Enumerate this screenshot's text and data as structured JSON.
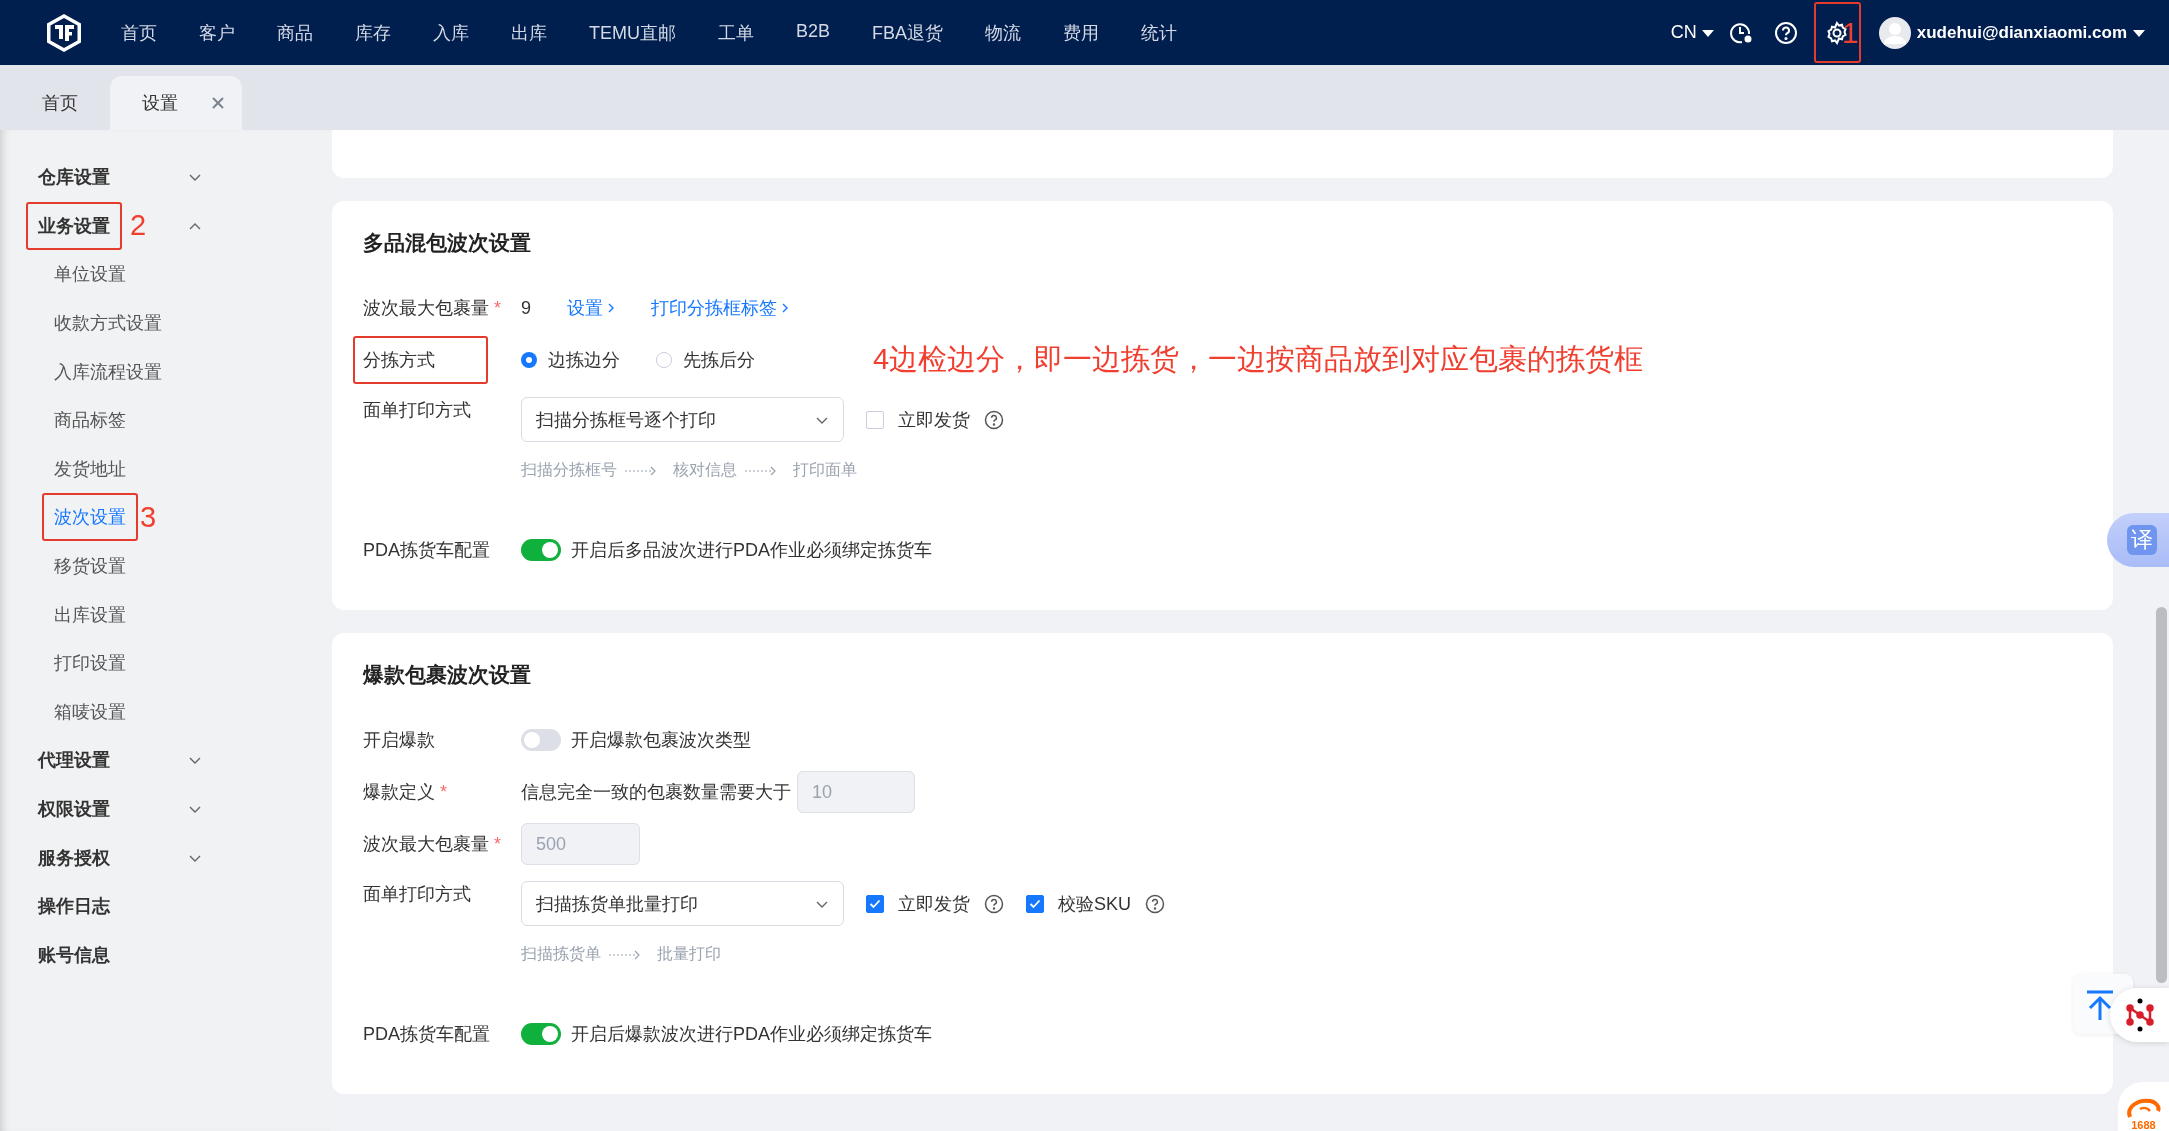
{
  "top_nav": {
    "items": [
      "首页",
      "客户",
      "商品",
      "库存",
      "入库",
      "出库",
      "TEMU直邮",
      "工单",
      "B2B",
      "FBA退货",
      "物流",
      "费用",
      "统计"
    ],
    "language": "CN",
    "user": "xudehui@dianxiaomi.com",
    "settings_annotation_box": true,
    "settings_annotation_number": "1"
  },
  "tabs": [
    {
      "label": "首页",
      "selected": false,
      "closable": false
    },
    {
      "label": "设置",
      "selected": true,
      "closable": true
    }
  ],
  "sidebar": {
    "items": [
      {
        "label": "仓库设置",
        "kind": "group",
        "expanded": false
      },
      {
        "label": "业务设置",
        "kind": "group",
        "expanded": true,
        "annotation_box": true,
        "annotation_number": "2",
        "children": [
          {
            "label": "单位设置",
            "selected": false
          },
          {
            "label": "收款方式设置",
            "selected": false
          },
          {
            "label": "入库流程设置",
            "selected": false
          },
          {
            "label": "商品标签",
            "selected": false
          },
          {
            "label": "发货地址",
            "selected": false
          },
          {
            "label": "波次设置",
            "selected": true,
            "annotation_box": true,
            "annotation_number": "3"
          },
          {
            "label": "移货设置",
            "selected": false
          },
          {
            "label": "出库设置",
            "selected": false
          },
          {
            "label": "打印设置",
            "selected": false
          },
          {
            "label": "箱唛设置",
            "selected": false
          }
        ]
      },
      {
        "label": "代理设置",
        "kind": "group",
        "expanded": false
      },
      {
        "label": "权限设置",
        "kind": "group",
        "expanded": false
      },
      {
        "label": "服务授权",
        "kind": "group",
        "expanded": false
      },
      {
        "label": "操作日志",
        "kind": "link"
      },
      {
        "label": "账号信息",
        "kind": "link"
      }
    ]
  },
  "sections": [
    {
      "title": "多品混包波次设置",
      "rows": [
        {
          "kind": "value_links",
          "label": "波次最大包裹量",
          "required_mark": "*",
          "value": "9",
          "links": [
            "设置",
            "打印分拣框标签"
          ]
        },
        {
          "kind": "radio",
          "label": "分拣方式",
          "annotation_box": true,
          "options": [
            {
              "label": "边拣边分",
              "selected": true
            },
            {
              "label": "先拣后分",
              "selected": false
            }
          ],
          "note": "4边检边分，即一边拣货，一边按商品放到对应包裹的拣货框"
        },
        {
          "kind": "select",
          "label": "面单打印方式",
          "value": "扫描分拣框号逐个打印",
          "checkboxes": [
            {
              "label": "立即发货",
              "checked": false
            }
          ],
          "steps": [
            "扫描分拣框号",
            "核对信息",
            "打印面单"
          ]
        },
        {
          "kind": "toggle",
          "label": "PDA拣货车配置",
          "on": true,
          "text": "开启后多品波次进行PDA作业必须绑定拣货车"
        }
      ]
    },
    {
      "title": "爆款包裹波次设置",
      "rows": [
        {
          "kind": "toggle",
          "label": "开启爆款",
          "on": false,
          "text": "开启爆款包裹波次类型"
        },
        {
          "kind": "threshold",
          "label": "爆款定义",
          "required_mark": "*",
          "text": "信息完全一致的包裹数量需要大于",
          "value": "10",
          "disabled": true
        },
        {
          "kind": "input",
          "label": "波次最大包裹量",
          "required_mark": "*",
          "value": "500",
          "disabled": true
        },
        {
          "kind": "select",
          "label": "面单打印方式",
          "value": "扫描拣货单批量打印",
          "checkboxes": [
            {
              "label": "立即发货",
              "checked": true
            },
            {
              "label": "校验SKU",
              "checked": true
            }
          ],
          "steps": [
            "扫描拣货单",
            "批量打印"
          ]
        },
        {
          "kind": "toggle",
          "label": "PDA拣货车配置",
          "on": true,
          "text": "开启后爆款波次进行PDA作业必须绑定拣货车"
        }
      ]
    }
  ],
  "floating": {
    "translate": "译",
    "logo_text": "1688"
  }
}
